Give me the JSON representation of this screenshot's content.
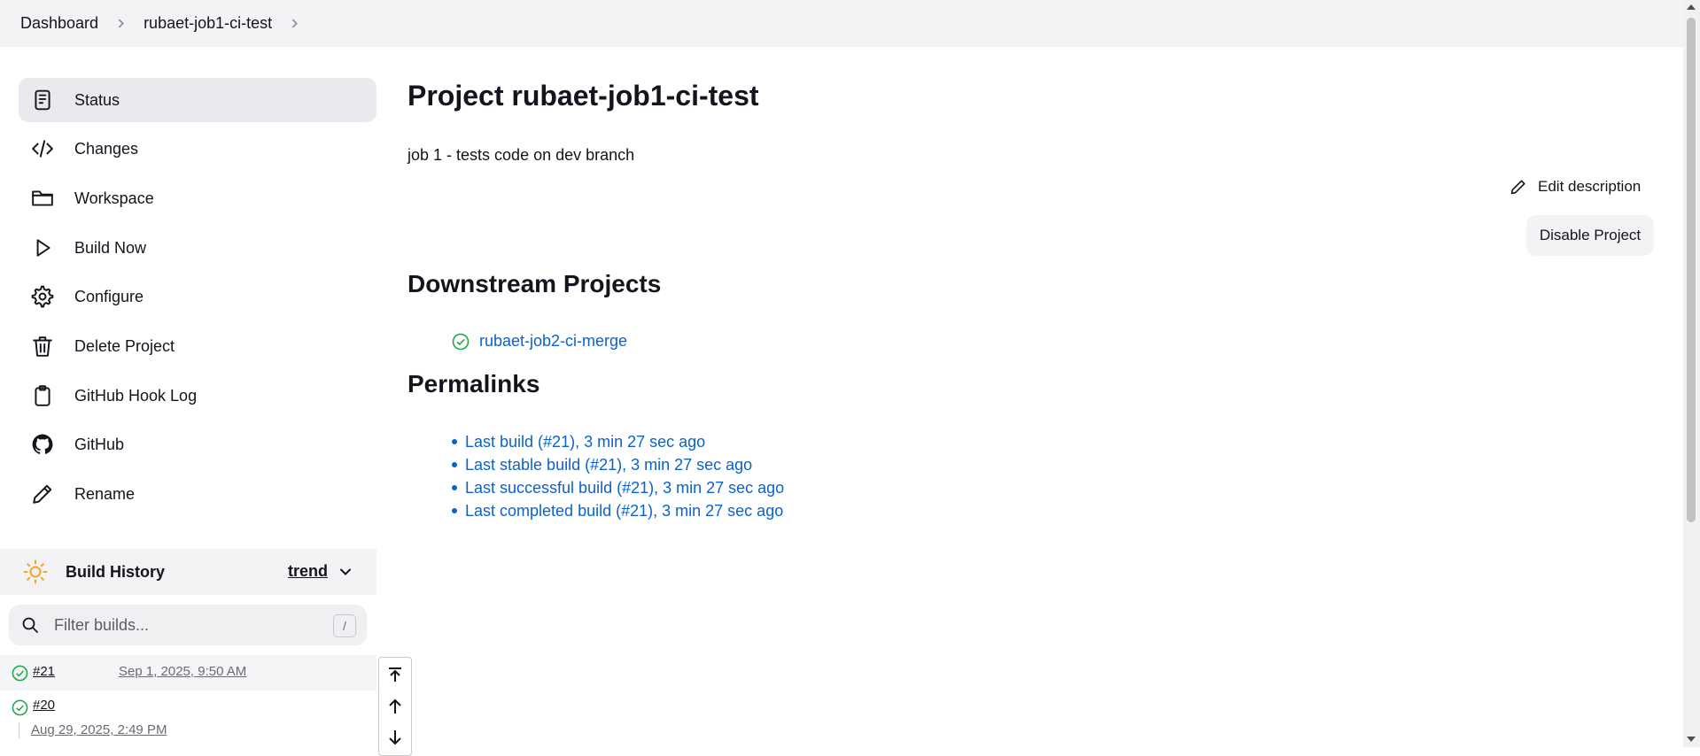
{
  "breadcrumb": {
    "items": [
      "Dashboard",
      "rubaet-job1-ci-test"
    ]
  },
  "sidebar": {
    "items": [
      {
        "label": "Status",
        "icon": "status-icon",
        "active": true
      },
      {
        "label": "Changes",
        "icon": "code-icon"
      },
      {
        "label": "Workspace",
        "icon": "folder-icon"
      },
      {
        "label": "Build Now",
        "icon": "play-icon"
      },
      {
        "label": "Configure",
        "icon": "gear-icon"
      },
      {
        "label": "Delete Project",
        "icon": "trash-icon"
      },
      {
        "label": "GitHub Hook Log",
        "icon": "clipboard-icon"
      },
      {
        "label": "GitHub",
        "icon": "github-icon"
      },
      {
        "label": "Rename",
        "icon": "pencil-icon"
      }
    ]
  },
  "build_history": {
    "title": "Build History",
    "trend_label": "trend",
    "filter_placeholder": "Filter builds...",
    "shortcut": "/",
    "builds": [
      {
        "number": "#21",
        "time": "Sep 1, 2025, 9:50 AM",
        "status": "success"
      },
      {
        "number": "#20",
        "time": "Aug 29, 2025, 2:49 PM",
        "status": "success"
      }
    ]
  },
  "main": {
    "title": "Project rubaet-job1-ci-test",
    "description": "job 1 - tests code on dev branch",
    "edit_description_label": "Edit description",
    "disable_button_label": "Disable Project",
    "downstream_heading": "Downstream Projects",
    "downstream_projects": [
      {
        "name": "rubaet-job2-ci-merge",
        "status": "success"
      }
    ],
    "permalinks_heading": "Permalinks",
    "permalinks": [
      "Last build (#21), 3 min 27 sec ago",
      "Last stable build (#21), 3 min 27 sec ago",
      "Last successful build (#21), 3 min 27 sec ago",
      "Last completed build (#21), 3 min 27 sec ago"
    ]
  },
  "colors": {
    "link": "#0b62cc",
    "success": "#1ea446",
    "sun": "#f5a623"
  }
}
